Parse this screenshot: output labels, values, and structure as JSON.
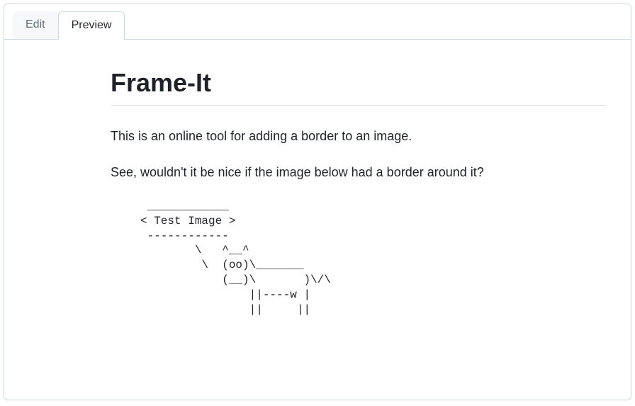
{
  "tabs": {
    "edit": "Edit",
    "preview": "Preview"
  },
  "readme": {
    "title": "Frame-It",
    "paragraph1": "This is an online tool for adding a border to an image.",
    "paragraph2": "See, wouldn't it be nice if the image below had a border around it?",
    "ascii": " ____________\n< Test Image >\n ------------\n        \\   ^__^\n         \\  (oo)\\_______\n            (__)\\       )\\/\\\n                ||----w |\n                ||     ||"
  }
}
